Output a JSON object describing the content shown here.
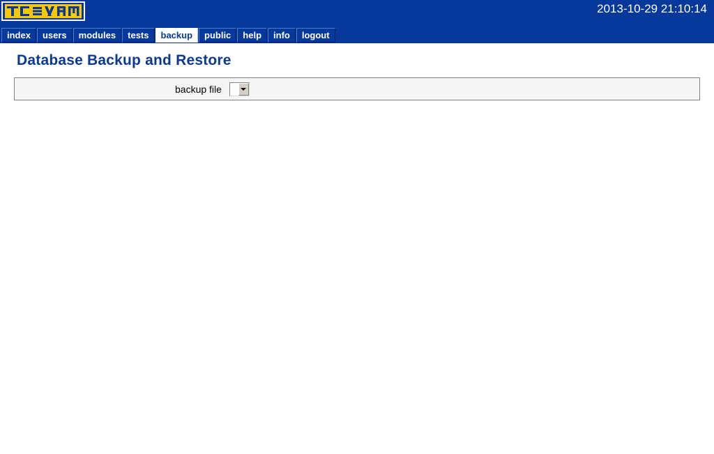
{
  "header": {
    "logo_text": "TCEXAM",
    "logo_icon": "tcexam-logo",
    "datetime": "2013-10-29 21:10:14",
    "colors": {
      "header_blue": "#06399B",
      "logo_gold": "#FCC800",
      "active_tab_bg": "#FFFFFF",
      "title_blue": "#0A3A91"
    }
  },
  "nav": {
    "tabs": [
      {
        "label": "index",
        "active": false
      },
      {
        "label": "users",
        "active": false
      },
      {
        "label": "modules",
        "active": false
      },
      {
        "label": "tests",
        "active": false
      },
      {
        "label": "backup",
        "active": true
      },
      {
        "label": "public",
        "active": false
      },
      {
        "label": "help",
        "active": false
      },
      {
        "label": "info",
        "active": false
      },
      {
        "label": "logout",
        "active": false
      }
    ]
  },
  "main": {
    "title": "Database Backup and Restore",
    "form": {
      "backup_file_label": "backup file",
      "backup_file_value": "",
      "backup_file_options": []
    }
  }
}
